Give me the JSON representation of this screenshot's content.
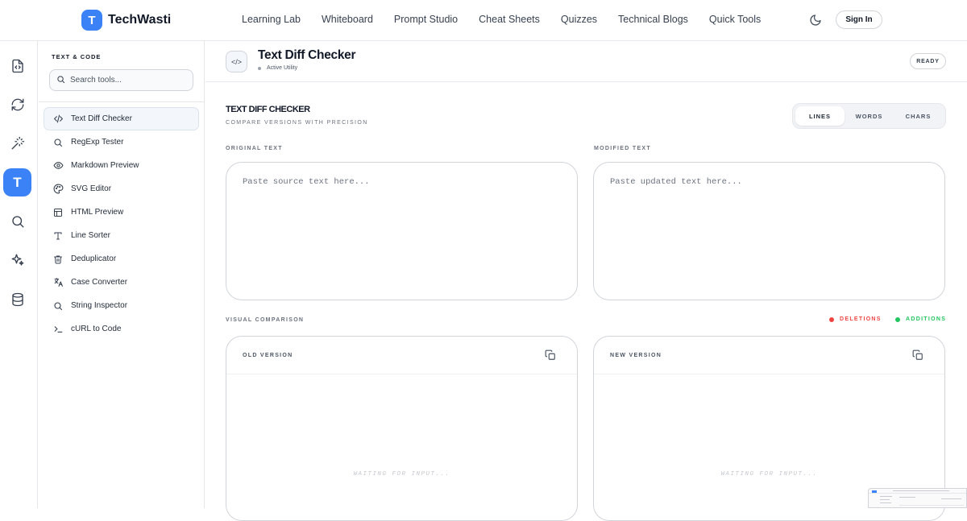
{
  "brand": {
    "logo_letter": "T",
    "name": "TechWasti",
    "accent": "#3b82f6"
  },
  "nav": {
    "links": [
      "Learning Lab",
      "Whiteboard",
      "Prompt Studio",
      "Cheat Sheets",
      "Quizzes",
      "Technical Blogs",
      "Quick Tools"
    ],
    "sign_in": "Sign In"
  },
  "rail": {
    "icons": [
      "file-code-icon",
      "refresh-icon",
      "magic-wand-icon",
      "text-icon",
      "search-icon",
      "sparkles-icon",
      "database-icon"
    ],
    "active_letter": "T"
  },
  "sidebar": {
    "heading": "TEXT & CODE",
    "search_placeholder": "Search tools...",
    "items": [
      {
        "label": "Text Diff Checker",
        "icon": "code-icon",
        "active": true
      },
      {
        "label": "RegExp Tester",
        "icon": "search-icon"
      },
      {
        "label": "Markdown Preview",
        "icon": "eye-icon"
      },
      {
        "label": "SVG Editor",
        "icon": "palette-icon"
      },
      {
        "label": "HTML Preview",
        "icon": "layout-icon"
      },
      {
        "label": "Line Sorter",
        "icon": "type-icon"
      },
      {
        "label": "Deduplicator",
        "icon": "trash-icon"
      },
      {
        "label": "Case Converter",
        "icon": "translate-icon"
      },
      {
        "label": "String Inspector",
        "icon": "search-icon"
      },
      {
        "label": "cURL to Code",
        "icon": "terminal-icon"
      }
    ]
  },
  "tool": {
    "icon_text": "</>",
    "title": "Text Diff Checker",
    "status": "Active Utility",
    "badge": "READY"
  },
  "section": {
    "title": "TEXT DIFF CHECKER",
    "subtitle": "COMPARE VERSIONS WITH PRECISION",
    "modes": [
      "LINES",
      "WORDS",
      "CHARS"
    ],
    "active_mode": "LINES"
  },
  "inputs": {
    "original_label": "ORIGINAL TEXT",
    "original_placeholder": "Paste source text here...",
    "original_value": "",
    "modified_label": "MODIFIED TEXT",
    "modified_placeholder": "Paste updated text here...",
    "modified_value": ""
  },
  "comparison": {
    "label": "VISUAL COMPARISON",
    "deletions": "DELETIONS",
    "additions": "ADDITIONS",
    "deletion_color": "#ef4444",
    "addition_color": "#22c55e",
    "old_title": "OLD VERSION",
    "new_title": "NEW VERSION",
    "waiting_text": "WAITING FOR INPUT..."
  }
}
